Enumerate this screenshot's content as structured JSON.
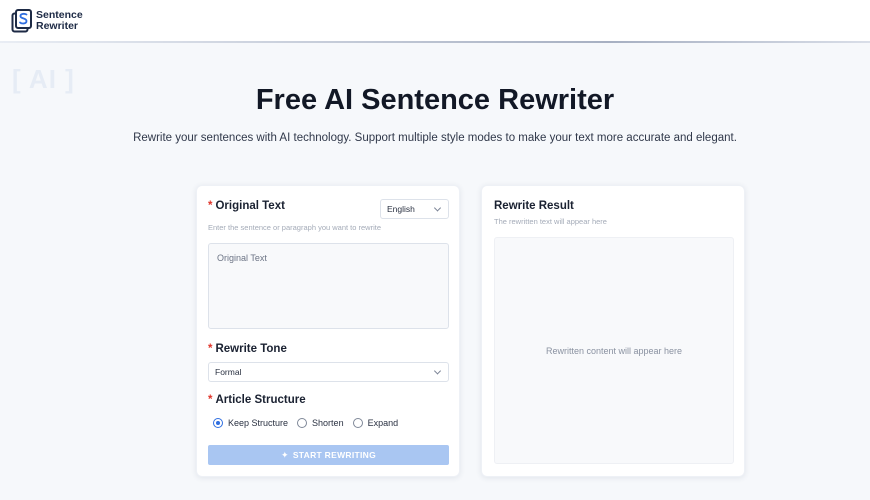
{
  "brand": {
    "line1": "Sentence",
    "line2": "Rewriter"
  },
  "decor": {
    "ai_badge": "[ AI ]"
  },
  "hero": {
    "title": "Free AI Sentence Rewriter",
    "subtitle": "Rewrite your sentences with AI technology. Support multiple style modes to make your text more accurate and elegant."
  },
  "left_panel": {
    "original_label": "Original Text",
    "original_hint": "Enter the sentence or paragraph you want to rewrite",
    "language_selected": "English",
    "textarea_placeholder": "Original Text",
    "tone_label": "Rewrite Tone",
    "tone_selected": "Formal",
    "structure_label": "Article Structure",
    "structure_options": [
      "Keep Structure",
      "Shorten",
      "Expand"
    ],
    "structure_selected": "Keep Structure",
    "start_button": "START REWRITING"
  },
  "right_panel": {
    "title": "Rewrite Result",
    "hint": "The rewritten text will appear here",
    "placeholder": "Rewritten content will appear here"
  },
  "colors": {
    "accent": "#2f6ee0",
    "button_disabled": "#a9c6f2",
    "required": "#e0352b"
  }
}
